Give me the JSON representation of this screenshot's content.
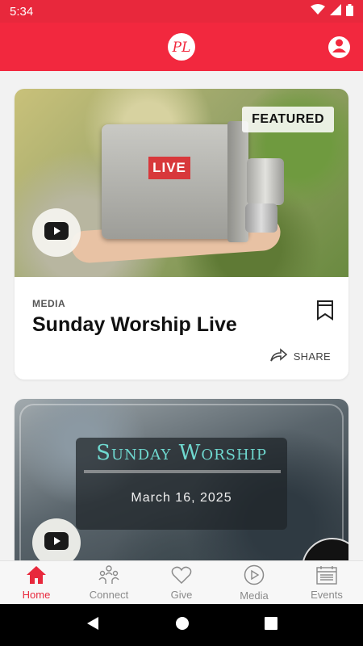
{
  "status_bar": {
    "time": "5:34",
    "icons": [
      "wifi-icon",
      "signal-icon",
      "battery-icon"
    ]
  },
  "app_bar": {
    "logo_text": "PL",
    "profile_icon": "profile-icon"
  },
  "feed": {
    "cards": [
      {
        "badge": "FEATURED",
        "image_label": "LIVE",
        "media_icon": "youtube-icon",
        "category": "MEDIA",
        "title": "Sunday Worship Live",
        "share_label": "SHARE",
        "bookmark_icon": "bookmark-icon"
      },
      {
        "image_title": "Sunday Worship",
        "image_date": "March 16, 2025",
        "media_icon": "youtube-icon"
      }
    ]
  },
  "bottom_nav": {
    "items": [
      {
        "label": "Home",
        "icon": "home-icon",
        "active": true
      },
      {
        "label": "Connect",
        "icon": "connect-icon",
        "active": false
      },
      {
        "label": "Give",
        "icon": "heart-icon",
        "active": false
      },
      {
        "label": "Media",
        "icon": "play-icon",
        "active": false
      },
      {
        "label": "Events",
        "icon": "calendar-icon",
        "active": false
      }
    ]
  },
  "system_nav": [
    "back-icon",
    "home-circle-icon",
    "recents-icon"
  ],
  "colors": {
    "brand_red": "#f2283e",
    "status_red": "#e8283c",
    "nav_inactive": "#8a8a8a",
    "title_teal": "#6fd8cf"
  }
}
